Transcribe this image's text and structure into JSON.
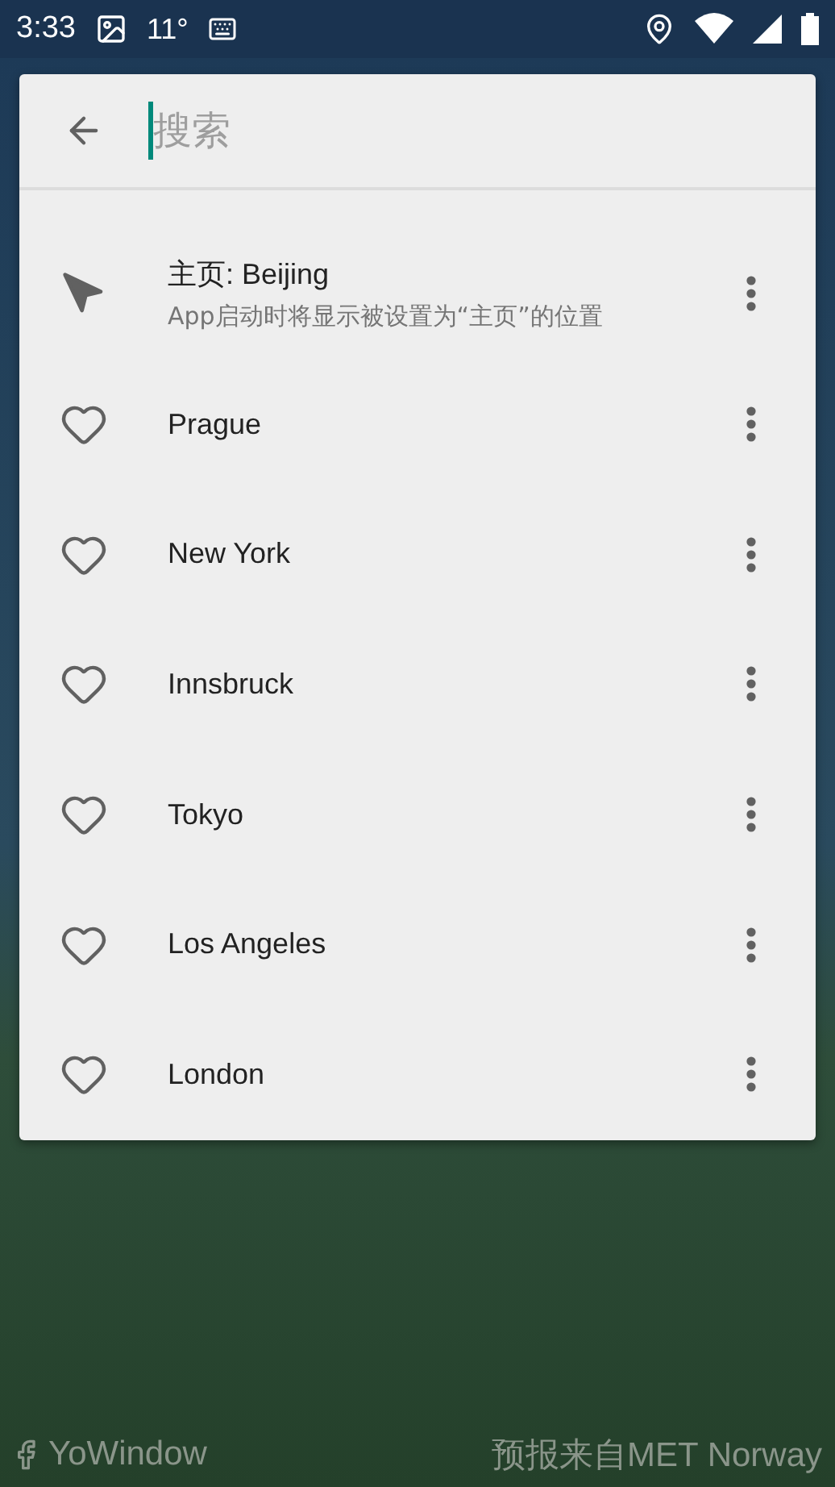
{
  "status_bar": {
    "time": "3:33",
    "temperature": "11°"
  },
  "search": {
    "placeholder": "搜索"
  },
  "locations": [
    {
      "kind": "home",
      "title": "主页: Beijing",
      "subtitle": "App启动时将显示被设置为“主页”的位置"
    },
    {
      "kind": "favorite",
      "title": "Prague"
    },
    {
      "kind": "favorite",
      "title": "New York"
    },
    {
      "kind": "favorite",
      "title": "Innsbruck"
    },
    {
      "kind": "favorite",
      "title": "Tokyo"
    },
    {
      "kind": "favorite",
      "title": "Los Angeles"
    },
    {
      "kind": "favorite",
      "title": "London"
    }
  ],
  "footer": {
    "brand": "YoWindow",
    "credit": "预报来自MET Norway"
  }
}
